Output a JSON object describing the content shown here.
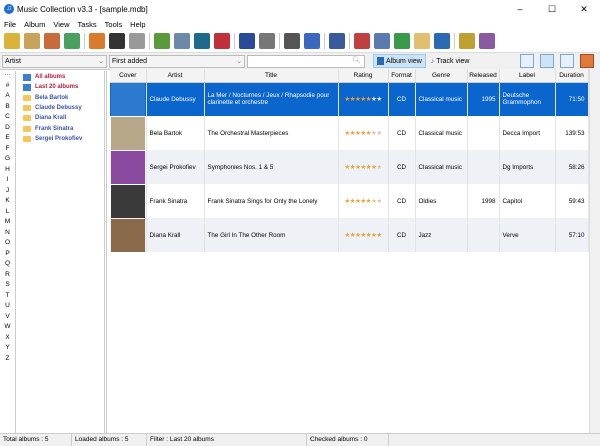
{
  "window": {
    "title": "Music Collection v3.3 - [sample.mdb]",
    "min": "–",
    "max": "☐",
    "close": "✕"
  },
  "menu": [
    "File",
    "Album",
    "View",
    "Tasks",
    "Tools",
    "Help"
  ],
  "toolbar_colors": [
    "#d9b43a",
    "#c8a35a",
    "#c86a3a",
    "#4aa060",
    "#d97b2a",
    "#333333",
    "#999999",
    "#5a9a3a",
    "#6a8aa8",
    "#1d6a8a",
    "#c0303a",
    "#2a4a9a",
    "#777777",
    "#555555",
    "#3a6ac0",
    "#3a5a9a",
    "#c04040",
    "#5a7ab0",
    "#3a9a4a",
    "#e0c070",
    "#2a6ab0",
    "#c0a030",
    "#8a5aa0"
  ],
  "filter": {
    "group": "Artist",
    "sort": "First added",
    "search_placeholder": "",
    "album_view": "Album view",
    "track_view": "Track view"
  },
  "alphabet": [
    "···",
    "#",
    "A",
    "B",
    "C",
    "D",
    "E",
    "F",
    "G",
    "H",
    "I",
    "J",
    "K",
    "L",
    "M",
    "N",
    "O",
    "P",
    "Q",
    "R",
    "S",
    "T",
    "U",
    "V",
    "W",
    "X",
    "Y",
    "Z"
  ],
  "tree": [
    {
      "label": "All albums",
      "type": "special"
    },
    {
      "label": "Last 20 albums",
      "type": "special"
    },
    {
      "label": "Bela Bartok"
    },
    {
      "label": "Claude Debussy"
    },
    {
      "label": "Diana Krall"
    },
    {
      "label": "Frank Sinatra"
    },
    {
      "label": "Sergei Prokofiev"
    }
  ],
  "columns": [
    "Cover",
    "Artist",
    "Title",
    "Rating",
    "Format",
    "Genre",
    "Released",
    "Label",
    "Duration"
  ],
  "rating_max": 7,
  "albums": [
    {
      "artist": "Claude Debussy",
      "title": "La Mer / Nocturnes / Jeux / Rhapsodie pour clarinette et orchestre",
      "rating": 5,
      "format": "CD",
      "genre": "Classical music",
      "released": "1995",
      "label": "Deutsche Grammophon",
      "duration": "71:50",
      "cover": "#2b7ad0",
      "selected": true
    },
    {
      "artist": "Bela Bartok",
      "title": "The Orchestral Masterpieces",
      "rating": 5,
      "format": "CD",
      "genre": "Classical music",
      "released": "",
      "label": "Decca Import",
      "duration": "139:53",
      "cover": "#b8a88a"
    },
    {
      "artist": "Sergei Prokofiev",
      "title": "Symphonies Nos. 1 & 5",
      "rating": 6,
      "format": "CD",
      "genre": "Classical music",
      "released": "",
      "label": "Dg Imports",
      "duration": "58:26",
      "cover": "#8a4aa0"
    },
    {
      "artist": "Frank Sinatra",
      "title": "Frank Sinatra Sings for Only the Lonely",
      "rating": 5,
      "format": "CD",
      "genre": "Oldies",
      "released": "1998",
      "label": "Capitol",
      "duration": "59:43",
      "cover": "#3a3a3a"
    },
    {
      "artist": "Diana Krall",
      "title": "The Girl In The Other Room",
      "rating": 7,
      "format": "CD",
      "genre": "Jazz",
      "released": "",
      "label": "Verve",
      "duration": "57:10",
      "cover": "#8a6a4a"
    }
  ],
  "status": {
    "total": "Total albums : 5",
    "loaded": "Loaded albums : 5",
    "filter": "Filter : Last 20 albums",
    "checked": "Checked albums : 0"
  }
}
